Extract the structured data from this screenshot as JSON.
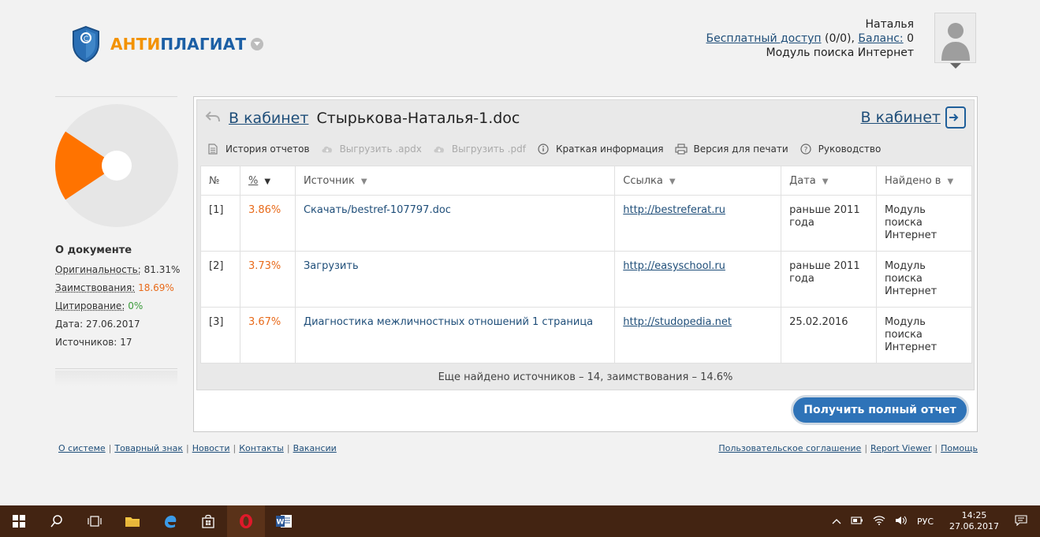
{
  "header": {
    "brand_part1": "АНТИ",
    "brand_part2": "ПЛАГИАТ",
    "user_name": "Наталья",
    "free_access_link": "Бесплатный доступ",
    "free_access_count": " (0/0), ",
    "balance_link": "Баланс:",
    "balance_value": " 0",
    "module": "Модуль поиска Интернет"
  },
  "sidebar": {
    "title": "О документе",
    "originality_label": "Оригинальность:",
    "originality_value": "81.31%",
    "borrowing_label": "Заимствования:",
    "borrowing_value": "18.69%",
    "citation_label": "Цитирование:",
    "citation_value": "0%",
    "date_label": "Дата:",
    "date_value": "27.06.2017",
    "sources_label": "Источников:",
    "sources_value": "17",
    "pie": {
      "originality": 81.31,
      "borrowing": 18.69,
      "citation": 0,
      "colors": {
        "originality": "#e6e6e6",
        "borrowing": "#ff7300"
      }
    }
  },
  "panel": {
    "back_link": "В кабинет",
    "doc_name": "Стырькова-Наталья-1.doc",
    "right_link": "В кабинет",
    "toolbar": [
      {
        "label": "История отчетов",
        "icon": "document-icon",
        "disabled": false
      },
      {
        "label": "Выгрузить .apdx",
        "icon": "cloud-download-icon",
        "disabled": true
      },
      {
        "label": "Выгрузить .pdf",
        "icon": "cloud-download-icon",
        "disabled": true
      },
      {
        "label": "Краткая информация",
        "icon": "info-icon",
        "disabled": false
      },
      {
        "label": "Версия для печати",
        "icon": "printer-icon",
        "disabled": false
      },
      {
        "label": "Руководство",
        "icon": "help-icon",
        "disabled": false
      }
    ],
    "table": {
      "headers": [
        "№",
        "%",
        "Источник",
        "Ссылка",
        "Дата",
        "Найдено в"
      ],
      "rows": [
        {
          "num": "[1]",
          "pct": "3.86%",
          "source": "Скачать/bestref-107797.doc",
          "url": "http://bestreferat.ru",
          "date": "раньше 2011 года",
          "found": "Модуль поиска Интернет"
        },
        {
          "num": "[2]",
          "pct": "3.73%",
          "source": "Загрузить",
          "url": "http://easyschool.ru",
          "date": "раньше 2011 года",
          "found": "Модуль поиска Интернет"
        },
        {
          "num": "[3]",
          "pct": "3.67%",
          "source": "Диагностика межличностных отношений 1 страница",
          "url": "http://studopedia.net",
          "date": "25.02.2016",
          "found": "Модуль поиска Интернет"
        }
      ]
    },
    "summary": "Еще найдено источников – 14, заимствования – 14.6%",
    "full_report_button": "Получить полный отчет"
  },
  "footer": {
    "left": [
      "О системе",
      "Товарный знак",
      "Новости",
      "Контакты",
      "Вакансии"
    ],
    "right": [
      "Пользовательское соглашение",
      "Report Viewer",
      "Помощь"
    ]
  },
  "taskbar": {
    "lang": "РУС",
    "time": "14:25",
    "date": "27.06.2017"
  }
}
